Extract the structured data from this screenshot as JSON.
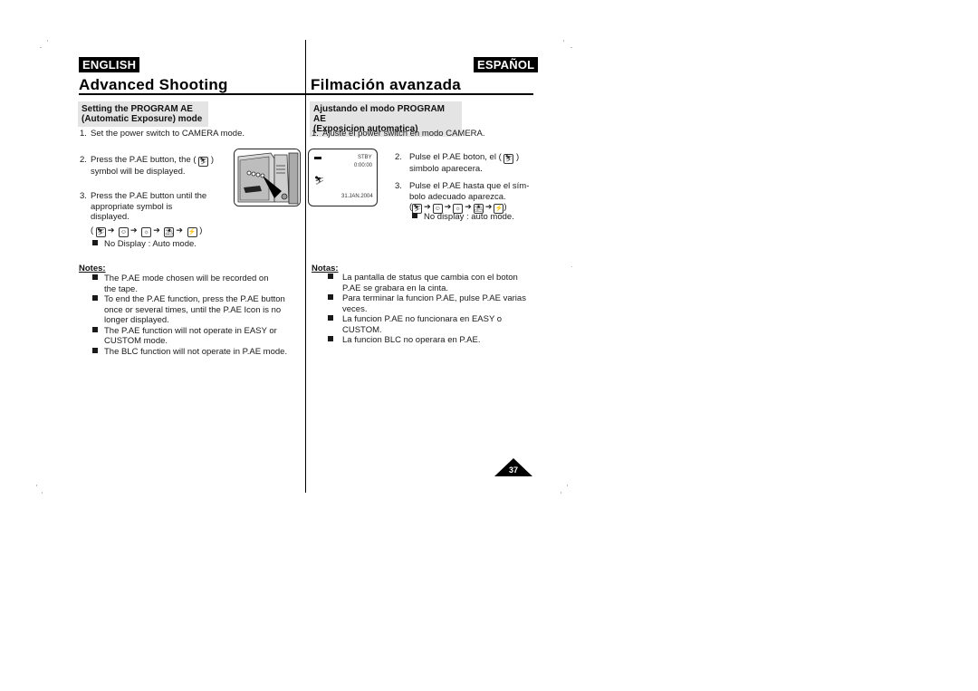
{
  "english": {
    "language_badge": "ENGLISH",
    "title": "Advanced Shooting",
    "section_heading_line1": "Setting the PROGRAM AE",
    "section_heading_line2": "(Automatic Exposure) mode",
    "steps": [
      {
        "num": "1.",
        "lines": [
          "Set the power switch to CAMERA mode."
        ]
      },
      {
        "num": "2.",
        "lines": [
          "Press the P.AE button, the (",
          ")",
          "symbol will be displayed."
        ]
      },
      {
        "num": "3.",
        "lines": [
          "Press the P.AE button until the",
          "appropriate symbol is",
          "displayed."
        ]
      }
    ],
    "mode_sequence_open": "(",
    "mode_sequence_close": ")",
    "no_display_note": "No Display :  Auto mode.",
    "notes_label": "Notes:",
    "notes": [
      [
        "The P.AE mode chosen will be recorded on",
        "the tape."
      ],
      [
        "To end the P.AE function, press the P.AE button",
        "once or several times, until the P.AE Icon is no",
        "longer displayed."
      ],
      [
        "The P.AE function will not operate in EASY or",
        "CUSTOM mode."
      ],
      [
        "The BLC function will not operate in P.AE mode."
      ]
    ]
  },
  "spanish": {
    "language_badge": "ESPAÑOL",
    "title": "Filmación avanzada",
    "section_heading_line1": "Ajustando el modo PROGRAM AE",
    "section_heading_line2": "(Exposicion automatica)",
    "steps": [
      {
        "num": "1.",
        "lines": [
          "Ajuste el power switch en modo CAMERA."
        ]
      },
      {
        "num": "2.",
        "lines": [
          "Pulse el P.AE boton, el (",
          ")",
          "simbolo aparecera."
        ]
      },
      {
        "num": "3.",
        "lines": [
          "Pulse el P.AE hasta que el sím-",
          "bolo adecuado aparezca."
        ]
      }
    ],
    "mode_sequence_open": "(",
    "mode_sequence_close": ")",
    "no_display_note": "No display : auto mode.",
    "notes_label": "Notas:",
    "notes": [
      [
        "La pantalla de status que cambia con el boton",
        "P.AE se grabara en la cinta."
      ],
      [
        "Para terminar la funcion P.AE, pulse P.AE varias",
        "veces."
      ],
      [
        "La funcion P.AE no funcionara en EASY o",
        "CUSTOM."
      ],
      [
        "La funcion BLC no operara en P.AE."
      ]
    ]
  },
  "lcd_display": {
    "status": "STBY",
    "timecode": "0:00:00",
    "date": "31.JAN.2004",
    "battery_icon": "battery-icon",
    "mode_icon": "sports-mode-icon"
  },
  "mode_icons": [
    "sports-mode-icon",
    "portrait-mode-icon",
    "spotlight-mode-icon",
    "sand-snow-mode-icon",
    "high-speed-shutter-icon"
  ],
  "mode_icon_glyphs": [
    "⛷",
    "☺",
    "☼",
    "⛱",
    "⚡"
  ],
  "arrow_glyph": "➔",
  "page_number": "37"
}
